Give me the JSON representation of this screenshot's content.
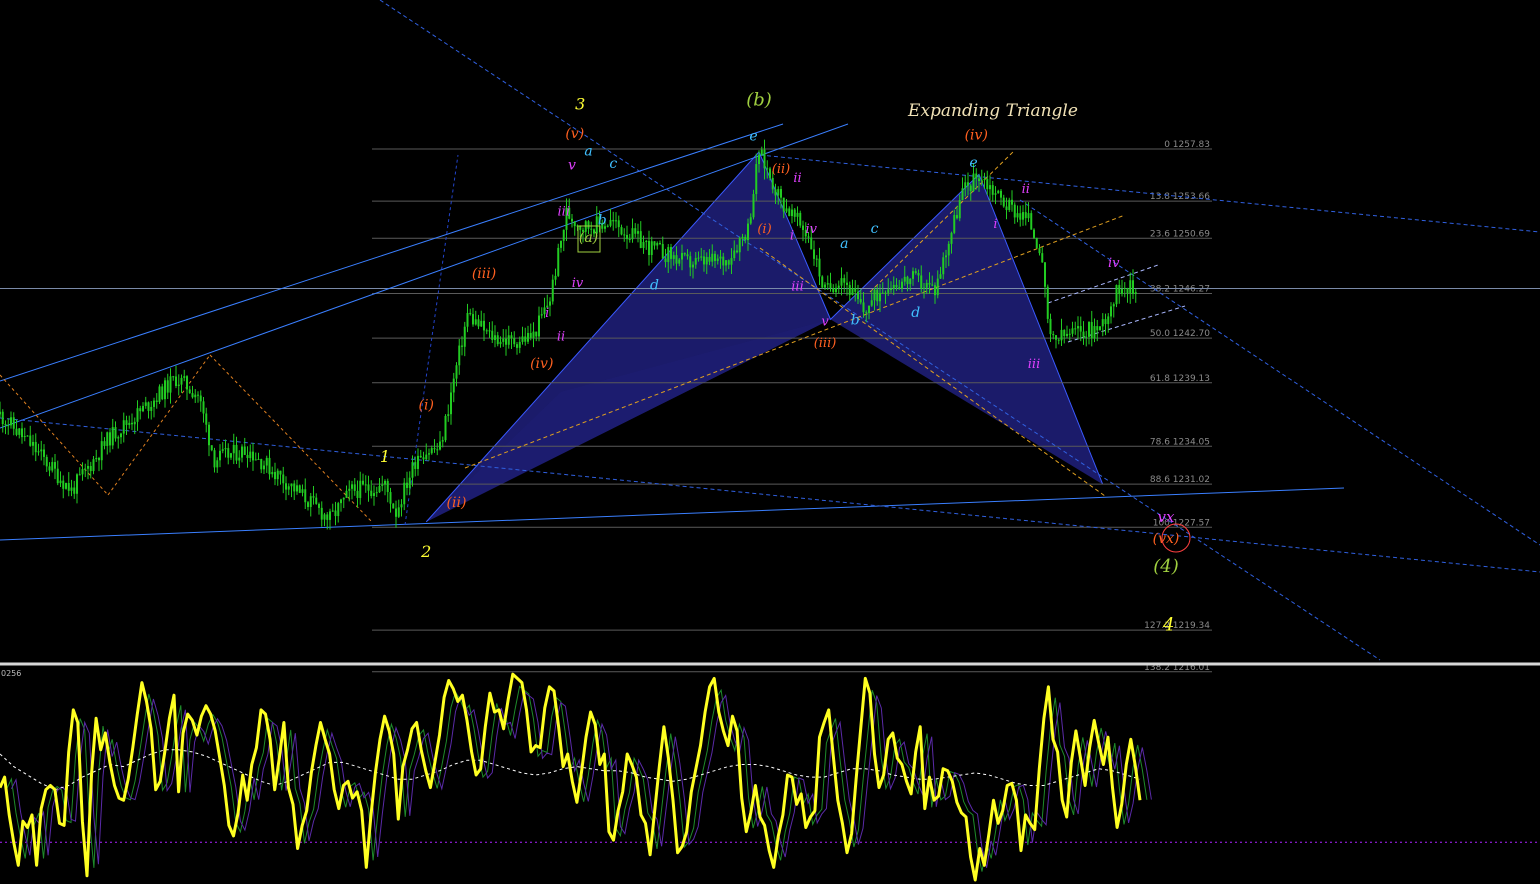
{
  "chart_data": [
    {
      "type": "candlestick",
      "title": "Expanding Triangle",
      "colors": {
        "background": "#000000",
        "candle": "#22cc22",
        "harmonic_fill": "#1c1c70",
        "trendline": "#3a7fff",
        "fib_line": "#5a5a5a",
        "pattern_line": "#e0a020"
      },
      "fib_levels": [
        {
          "ratio": "0",
          "price": 1257.83,
          "label": "0 1257.83"
        },
        {
          "ratio": "13.8",
          "price": 1253.66,
          "label": "13.8 1253.66"
        },
        {
          "ratio": "23.6",
          "price": 1250.69,
          "label": "23.6 1250.69"
        },
        {
          "ratio": "38.2",
          "price": 1246.27,
          "label": "38.2 1246.27"
        },
        {
          "ratio": "50.0",
          "price": 1242.7,
          "label": "50.0 1242.70"
        },
        {
          "ratio": "61.8",
          "price": 1239.13,
          "label": "61.8 1239.13"
        },
        {
          "ratio": "78.6",
          "price": 1234.05,
          "label": "78.6 1234.05"
        },
        {
          "ratio": "88.6",
          "price": 1231.02,
          "label": "88.6 1231.02"
        },
        {
          "ratio": "100",
          "price": 1227.57,
          "label": "100 1227.57"
        },
        {
          "ratio": "127.2",
          "price": 1219.34,
          "label": "127.2 1219.34"
        },
        {
          "ratio": "138.2",
          "price": 1216.01,
          "label": "138.2 1216.01"
        }
      ],
      "price_path": [
        {
          "bar": 0,
          "price": 1236.6
        },
        {
          "bar": 12,
          "price": 1234.0
        },
        {
          "bar": 26,
          "price": 1230.5
        },
        {
          "bar": 40,
          "price": 1234.8
        },
        {
          "bar": 52,
          "price": 1237.0
        },
        {
          "bar": 64,
          "price": 1239.5
        },
        {
          "bar": 72,
          "price": 1238.2
        },
        {
          "bar": 78,
          "price": 1233.0
        },
        {
          "bar": 90,
          "price": 1233.8
        },
        {
          "bar": 102,
          "price": 1231.6
        },
        {
          "bar": 120,
          "price": 1228.2
        },
        {
          "bar": 128,
          "price": 1230.5
        },
        {
          "bar": 140,
          "price": 1230.9
        },
        {
          "bar": 144,
          "price": 1228.8
        },
        {
          "bar": 152,
          "price": 1233.5
        },
        {
          "bar": 160,
          "price": 1233.9
        },
        {
          "bar": 166,
          "price": 1240.4
        },
        {
          "bar": 170,
          "price": 1244.6
        },
        {
          "bar": 178,
          "price": 1242.9
        },
        {
          "bar": 186,
          "price": 1242.4
        },
        {
          "bar": 194,
          "price": 1242.9
        },
        {
          "bar": 200,
          "price": 1245.9
        },
        {
          "bar": 206,
          "price": 1252.7
        },
        {
          "bar": 212,
          "price": 1251.6
        },
        {
          "bar": 222,
          "price": 1252.0
        },
        {
          "bar": 236,
          "price": 1250.0
        },
        {
          "bar": 250,
          "price": 1248.7
        },
        {
          "bar": 264,
          "price": 1248.9
        },
        {
          "bar": 272,
          "price": 1251.5
        },
        {
          "bar": 276,
          "price": 1257.6
        },
        {
          "bar": 284,
          "price": 1253.7
        },
        {
          "bar": 294,
          "price": 1250.9
        },
        {
          "bar": 300,
          "price": 1246.4
        },
        {
          "bar": 306,
          "price": 1247.7
        },
        {
          "bar": 314,
          "price": 1244.8
        },
        {
          "bar": 322,
          "price": 1247.0
        },
        {
          "bar": 332,
          "price": 1247.4
        },
        {
          "bar": 340,
          "price": 1246.6
        },
        {
          "bar": 350,
          "price": 1254.4
        },
        {
          "bar": 356,
          "price": 1255.8
        },
        {
          "bar": 366,
          "price": 1253.4
        },
        {
          "bar": 374,
          "price": 1252.2
        },
        {
          "bar": 378,
          "price": 1250.0
        },
        {
          "bar": 382,
          "price": 1242.4
        },
        {
          "bar": 390,
          "price": 1243.1
        },
        {
          "bar": 400,
          "price": 1243.5
        },
        {
          "bar": 408,
          "price": 1247.2
        },
        {
          "bar": 414,
          "price": 1246.2
        }
      ],
      "wave_labels": [
        {
          "text": "1",
          "bar": 140,
          "price": 1232.8,
          "color": "#ffff33",
          "size": 16
        },
        {
          "text": "2",
          "bar": 155,
          "price": 1225.2,
          "color": "#ffff33",
          "size": 16
        },
        {
          "text": "3",
          "bar": 211,
          "price": 1261.0,
          "color": "#ffff33",
          "size": 16
        },
        {
          "text": "4",
          "bar": 425,
          "price": 1219.3,
          "color": "#ffff33",
          "size": 18
        },
        {
          "text": "(i)",
          "bar": 155,
          "price": 1237.0,
          "color": "#ff6020",
          "size": 14
        },
        {
          "text": "(ii)",
          "bar": 166,
          "price": 1229.2,
          "color": "#ff6020",
          "size": 14
        },
        {
          "text": "(iii)",
          "bar": 176,
          "price": 1247.5,
          "color": "#ff6020",
          "size": 14
        },
        {
          "text": "(iv)",
          "bar": 197,
          "price": 1240.3,
          "color": "#ff6020",
          "size": 14
        },
        {
          "text": "(v)",
          "bar": 209,
          "price": 1258.7,
          "color": "#ff6020",
          "size": 14
        },
        {
          "text": "(i)",
          "bar": 278,
          "price": 1251.1,
          "color": "#ff6020",
          "size": 13
        },
        {
          "text": "(ii)",
          "bar": 284,
          "price": 1255.9,
          "color": "#ff6020",
          "size": 13
        },
        {
          "text": "(iii)",
          "bar": 300,
          "price": 1242.0,
          "color": "#ff6020",
          "size": 13
        },
        {
          "text": "(iv)",
          "bar": 355,
          "price": 1258.6,
          "color": "#ff6020",
          "size": 14
        },
        {
          "text": "(vx)",
          "bar": 424,
          "price": 1226.3,
          "color": "#ff6020",
          "size": 14
        },
        {
          "text": "(b)",
          "bar": 276,
          "price": 1261.3,
          "color": "#a0d040",
          "size": 18
        },
        {
          "text": "(a)",
          "bar": 214,
          "price": 1250.4,
          "color": "#a0d040",
          "size": 14
        },
        {
          "text": "(4)",
          "bar": 424,
          "price": 1224.0,
          "color": "#a0d040",
          "size": 18
        },
        {
          "text": "a",
          "bar": 214,
          "price": 1257.3,
          "color": "#40c0ff",
          "size": 14
        },
        {
          "text": "b",
          "bar": 219,
          "price": 1251.8,
          "color": "#40c0ff",
          "size": 14
        },
        {
          "text": "c",
          "bar": 223,
          "price": 1256.3,
          "color": "#40c0ff",
          "size": 14
        },
        {
          "text": "d",
          "bar": 238,
          "price": 1246.6,
          "color": "#40c0ff",
          "size": 14
        },
        {
          "text": "e",
          "bar": 274,
          "price": 1258.5,
          "color": "#40c0ff",
          "size": 14
        },
        {
          "text": "a",
          "bar": 307,
          "price": 1249.9,
          "color": "#40c0ff",
          "size": 14
        },
        {
          "text": "b",
          "bar": 311,
          "price": 1243.8,
          "color": "#40c0ff",
          "size": 14
        },
        {
          "text": "c",
          "bar": 318,
          "price": 1251.1,
          "color": "#40c0ff",
          "size": 14
        },
        {
          "text": "d",
          "bar": 333,
          "price": 1244.4,
          "color": "#40c0ff",
          "size": 14
        },
        {
          "text": "e",
          "bar": 354,
          "price": 1256.4,
          "color": "#40c0ff",
          "size": 14
        },
        {
          "text": "v",
          "bar": 208,
          "price": 1256.2,
          "color": "#e040ff",
          "size": 14
        },
        {
          "text": "iii",
          "bar": 205,
          "price": 1252.5,
          "color": "#e040ff",
          "size": 13
        },
        {
          "text": "iv",
          "bar": 210,
          "price": 1246.8,
          "color": "#e040ff",
          "size": 13
        },
        {
          "text": "i",
          "bar": 199,
          "price": 1244.4,
          "color": "#e040ff",
          "size": 13
        },
        {
          "text": "ii",
          "bar": 204,
          "price": 1242.5,
          "color": "#e040ff",
          "size": 13
        },
        {
          "text": "ii",
          "bar": 290,
          "price": 1255.2,
          "color": "#e040ff",
          "size": 13
        },
        {
          "text": "i",
          "bar": 288,
          "price": 1250.6,
          "color": "#e040ff",
          "size": 13
        },
        {
          "text": "iv",
          "bar": 295,
          "price": 1251.1,
          "color": "#e040ff",
          "size": 13
        },
        {
          "text": "iii",
          "bar": 290,
          "price": 1246.5,
          "color": "#e040ff",
          "size": 13
        },
        {
          "text": "v",
          "bar": 300,
          "price": 1243.7,
          "color": "#e040ff",
          "size": 13
        },
        {
          "text": "ii",
          "bar": 373,
          "price": 1254.3,
          "color": "#e040ff",
          "size": 13
        },
        {
          "text": "i",
          "bar": 362,
          "price": 1251.5,
          "color": "#e040ff",
          "size": 13
        },
        {
          "text": "iii",
          "bar": 376,
          "price": 1240.3,
          "color": "#e040ff",
          "size": 13
        },
        {
          "text": "iv",
          "bar": 405,
          "price": 1248.4,
          "color": "#e040ff",
          "size": 13
        },
        {
          "text": "vx",
          "bar": 424,
          "price": 1228.0,
          "color": "#e040ff",
          "size": 15
        }
      ]
    },
    {
      "type": "line",
      "panel": "oscillator",
      "label": "0256",
      "series": [
        {
          "color": "#ffff22",
          "values": [
            44,
            49,
            31,
            18,
            7,
            28,
            25,
            31,
            7,
            34,
            43,
            45,
            43,
            27,
            26,
            61,
            81,
            75,
            28,
            2,
            51,
            77,
            62,
            70,
            56,
            45,
            39,
            38,
            48,
            63,
            79,
            94,
            85,
            72,
            43,
            47,
            61,
            77,
            88,
            42,
            70,
            79,
            76,
            69,
            78,
            83,
            79,
            71,
            58,
            45,
            26,
            21,
            32,
            50,
            38,
            55,
            63,
            81,
            79,
            67,
            43,
            58,
            75,
            44,
            36,
            15,
            26,
            33,
            51,
            64,
            75,
            67,
            60,
            43,
            34,
            45,
            47,
            39,
            42,
            33,
            6,
            30,
            51,
            67,
            78,
            71,
            60,
            29,
            54,
            62,
            72,
            75,
            62,
            52,
            44,
            56,
            69,
            87,
            95,
            91,
            85,
            88,
            76,
            61,
            50,
            53,
            73,
            89,
            80,
            81,
            72,
            86,
            98,
            96,
            94,
            81,
            61,
            64,
            63,
            82,
            92,
            90,
            73,
            54,
            60,
            47,
            37,
            51,
            68,
            80,
            74,
            55,
            60,
            23,
            19,
            33,
            42,
            60,
            55,
            49,
            31,
            27,
            12,
            33,
            54,
            73,
            58,
            38,
            13,
            16,
            23,
            42,
            53,
            64,
            80,
            92,
            96,
            80,
            71,
            64,
            78,
            71,
            39,
            23,
            32,
            45,
            30,
            26,
            14,
            6,
            21,
            31,
            50,
            49,
            36,
            41,
            25,
            30,
            33,
            68,
            75,
            81,
            59,
            38,
            27,
            13,
            22,
            48,
            72,
            96,
            89,
            60,
            44,
            50,
            67,
            70,
            58,
            55,
            47,
            41,
            61,
            73,
            34,
            49,
            38,
            40,
            53,
            52,
            47,
            37,
            32,
            30,
            11,
            0,
            15,
            7,
            22,
            38,
            27,
            33,
            45,
            46,
            38,
            14,
            31,
            27,
            24,
            53,
            77,
            92,
            67,
            61,
            38,
            30,
            56,
            71,
            58,
            45,
            63,
            76,
            65,
            55,
            68,
            44,
            25,
            36,
            55,
            67,
            54,
            38
          ]
        },
        {
          "color": "#ffffff",
          "style": "dashed",
          "values": [
            60,
            54,
            50,
            46,
            43,
            45,
            49,
            52,
            55,
            54,
            57,
            60,
            62,
            62,
            61,
            59,
            56,
            53,
            50,
            47,
            45,
            47,
            50,
            53,
            56,
            56,
            54,
            52,
            50,
            48,
            48,
            50,
            52,
            55,
            57,
            57,
            55,
            53,
            51,
            50,
            51,
            53,
            54,
            53,
            52,
            52,
            51,
            49,
            48,
            47,
            48,
            50,
            52,
            54,
            55,
            55,
            54,
            52,
            50,
            49,
            49,
            51,
            53,
            53,
            52,
            50,
            49,
            48,
            48,
            49,
            50,
            51,
            50,
            48,
            46,
            45,
            45,
            47,
            49,
            51,
            53,
            52,
            50,
            48
          ]
        },
        {
          "color": "#aa22ff",
          "style": "dotted",
          "values": [
            18
          ]
        }
      ]
    }
  ]
}
